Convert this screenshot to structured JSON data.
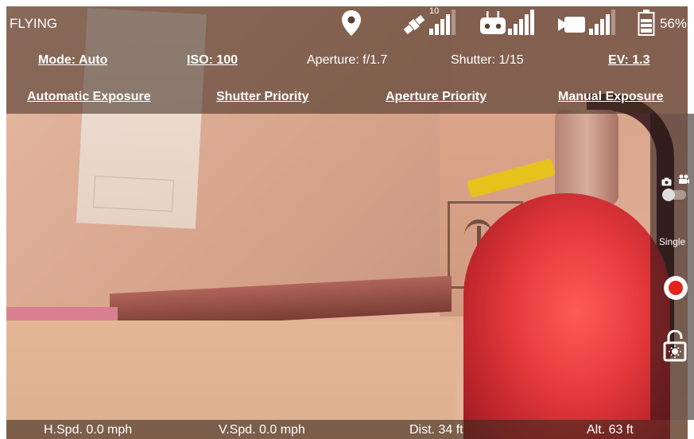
{
  "status": {
    "flight_state": "FLYING",
    "satellite_count": "10",
    "battery_percent": "56%",
    "icons": [
      "location-pin-icon",
      "satellite-icon",
      "remote-controller-icon",
      "video-link-icon",
      "battery-icon"
    ]
  },
  "exposure": {
    "mode": "Mode: Auto",
    "iso": "ISO: 100",
    "aperture": "Aperture: f/1.7",
    "shutter": "Shutter: 1/15",
    "ev": "EV: 1.3"
  },
  "modes": {
    "automatic": "Automatic Exposure",
    "shutter_priority": "Shutter Priority",
    "aperture_priority": "Aperture Priority",
    "manual": "Manual Exposure"
  },
  "camera_panel": {
    "shoot_mode": "Single",
    "icons": [
      "camera-icon",
      "video-camera-icon",
      "record-icon",
      "unlock-exposure-icon"
    ]
  },
  "telemetry": {
    "h_speed": "H.Spd. 0.0 mph",
    "v_speed": "V.Spd. 0.0 mph",
    "distance": "Dist. 34 ft",
    "altitude": "Alt. 63 ft"
  },
  "colors": {
    "record_red": "#e3231c",
    "overlay": "#3c281e"
  }
}
